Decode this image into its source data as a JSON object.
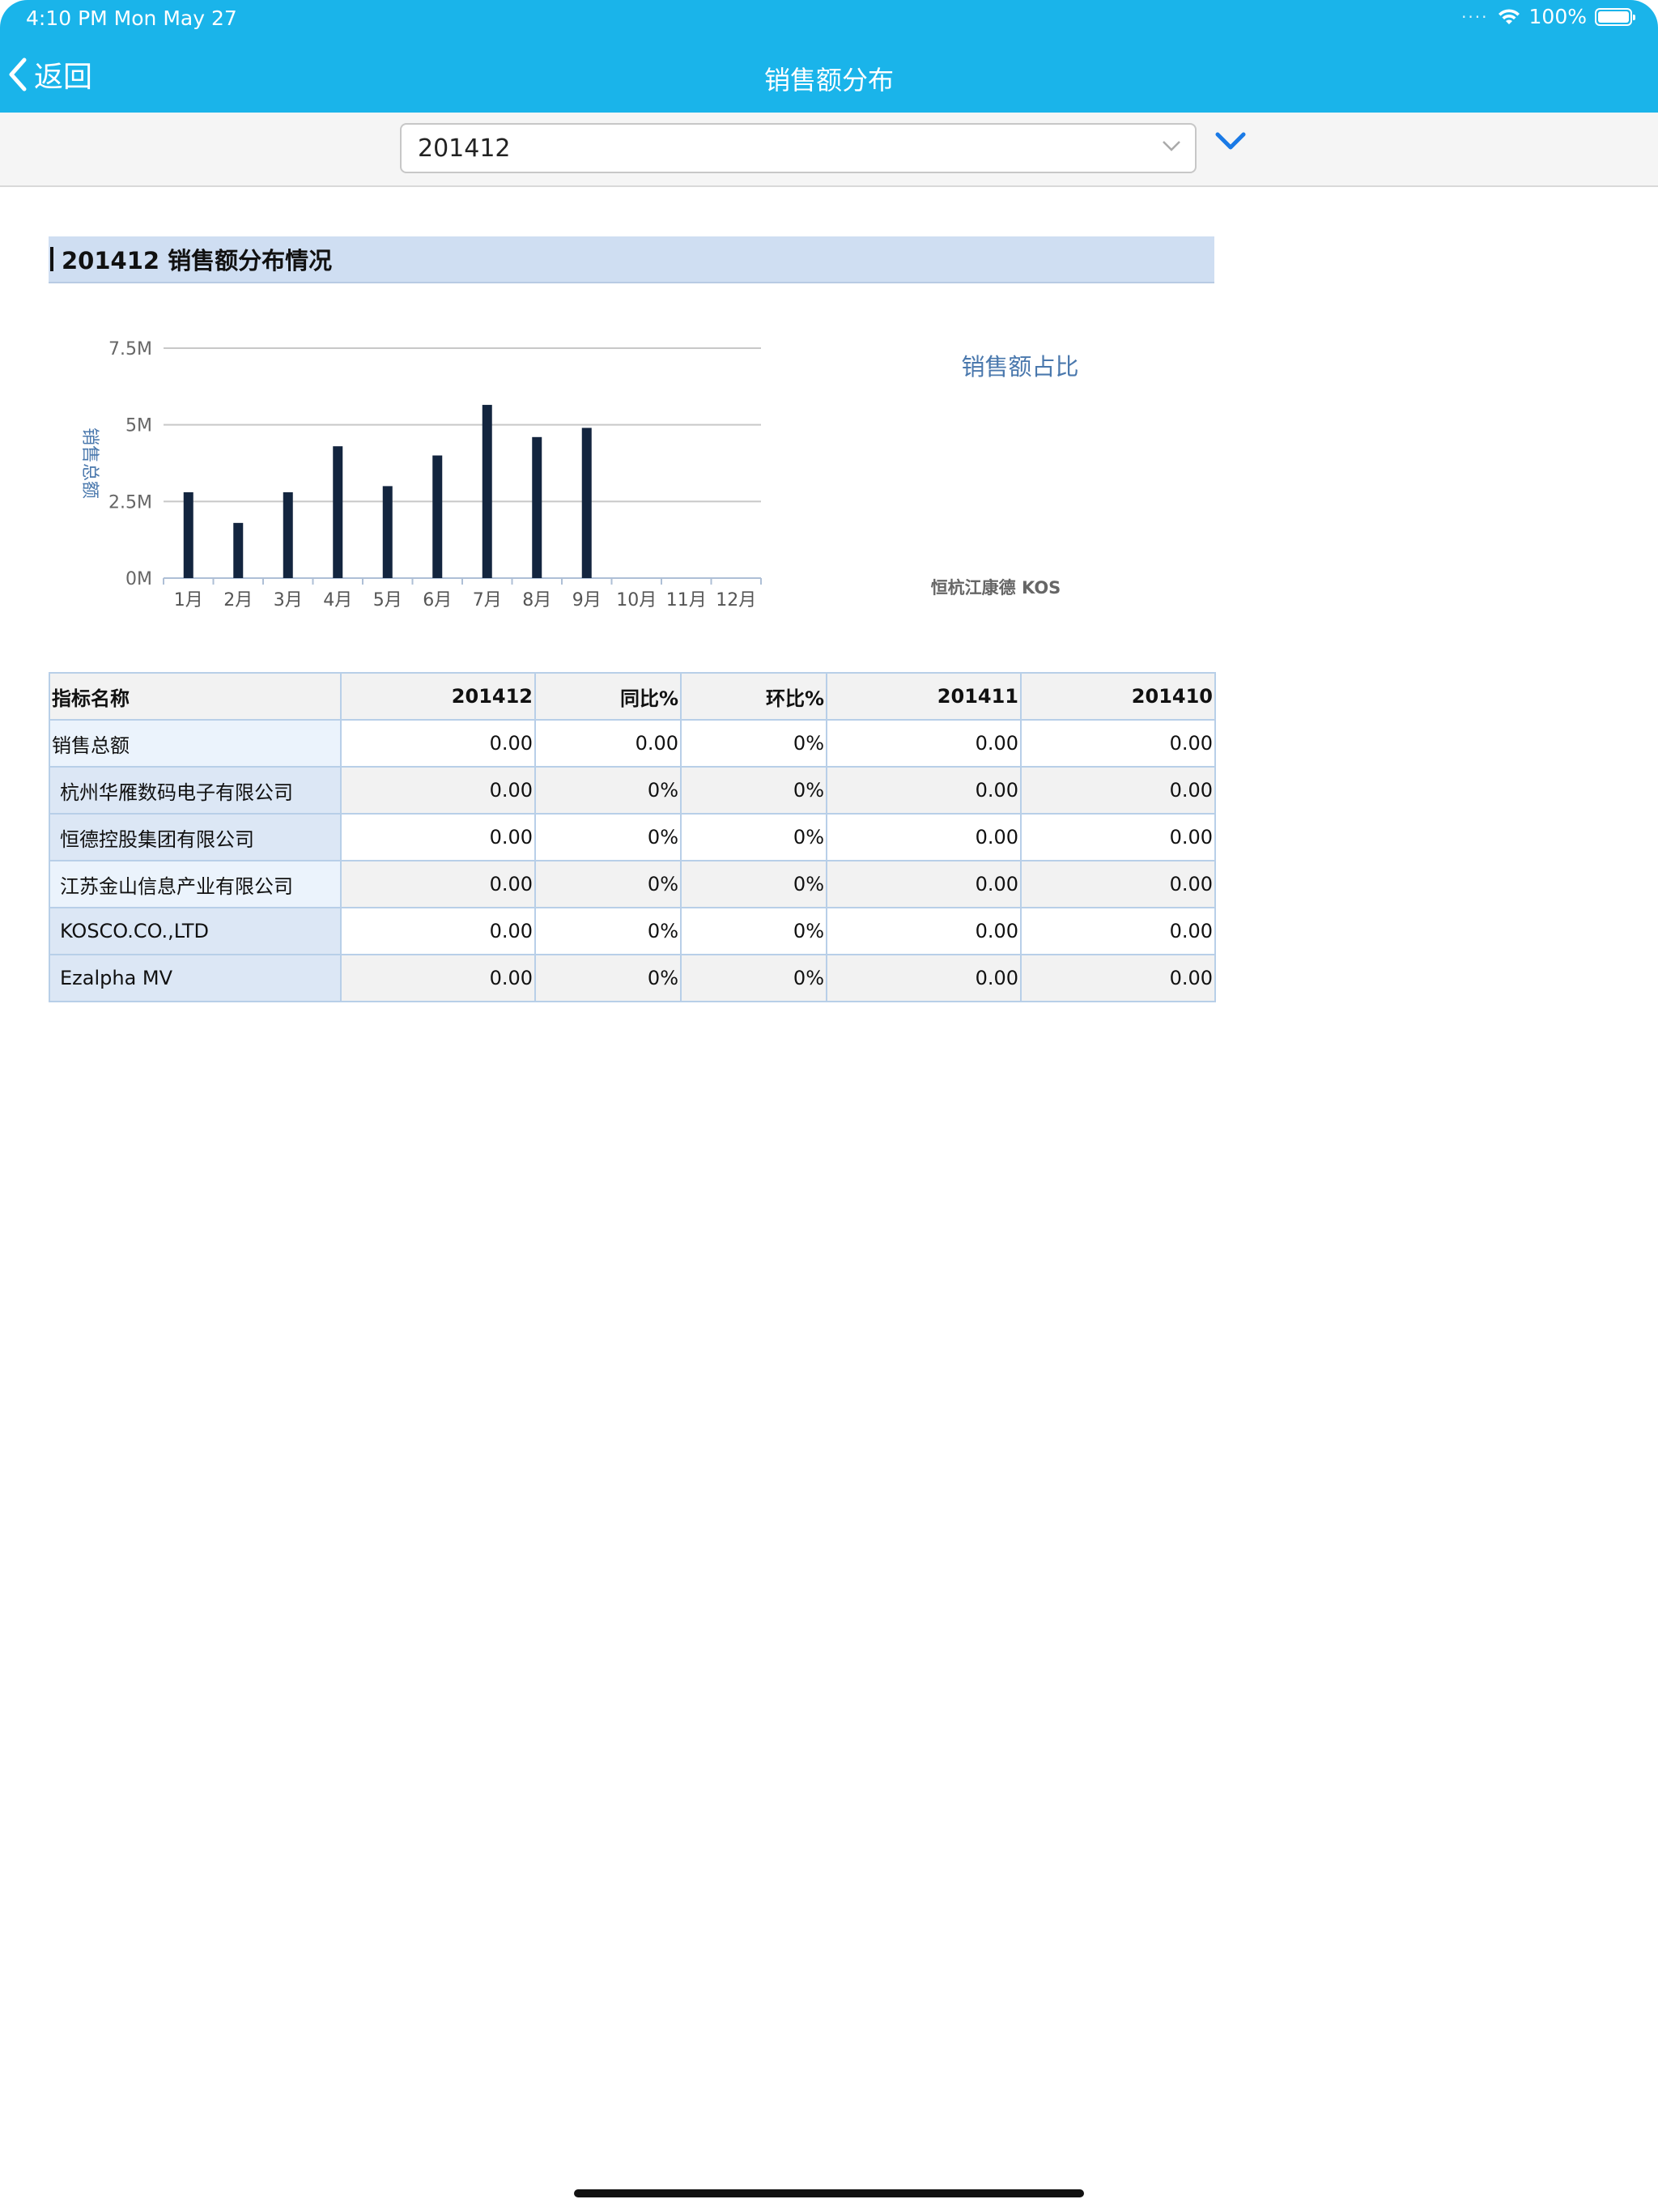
{
  "status_bar": {
    "time_date": "4:10 PM   Mon May 27",
    "battery": "100%"
  },
  "nav": {
    "back_label": "返回",
    "title": "销售额分布"
  },
  "selector": {
    "value": "201412"
  },
  "section": {
    "title": "201412  销售额分布情况"
  },
  "chart_data": {
    "type": "bar",
    "title": "",
    "ylabel": "销售总额",
    "xlabel": "",
    "categories": [
      "1月",
      "2月",
      "3月",
      "4月",
      "5月",
      "6月",
      "7月",
      "8月",
      "9月",
      "10月",
      "11月",
      "12月"
    ],
    "values": [
      2.8,
      1.8,
      2.8,
      4.3,
      3.0,
      4.0,
      5.65,
      4.6,
      4.9,
      null,
      null,
      null
    ],
    "unit": "M",
    "yticks": [
      "0M",
      "2.5M",
      "5M",
      "7.5M"
    ],
    "ylim": [
      0,
      7.5
    ],
    "grid": true,
    "bar_color": "#13253f"
  },
  "pie": {
    "title": "销售额占比",
    "label_text": "恒杭江康德 KOS"
  },
  "table": {
    "headers": [
      "指标名称",
      "201412",
      "同比%",
      "环比%",
      "201411",
      "201410"
    ],
    "rows": [
      {
        "name": "销售总额",
        "cells": [
          "0.00",
          "0.00",
          "0%",
          "0.00",
          "0.00"
        ]
      },
      {
        "name": "杭州华雁数码电子有限公司",
        "cells": [
          "0.00",
          "0%",
          "0%",
          "0.00",
          "0.00"
        ]
      },
      {
        "name": "恒德控股集团有限公司",
        "cells": [
          "0.00",
          "0%",
          "0%",
          "0.00",
          "0.00"
        ]
      },
      {
        "name": "江苏金山信息产业有限公司",
        "cells": [
          "0.00",
          "0%",
          "0%",
          "0.00",
          "0.00"
        ]
      },
      {
        "name": "KOSCO.CO.,LTD",
        "cells": [
          "0.00",
          "0%",
          "0%",
          "0.00",
          "0.00"
        ]
      },
      {
        "name": "Ezalpha MV",
        "cells": [
          "0.00",
          "0%",
          "0%",
          "0.00",
          "0.00"
        ]
      }
    ]
  },
  "colors": {
    "nav_bg": "#1ab4ea",
    "accent_blue": "#1a7ae6",
    "header_band": "#cfdef2"
  }
}
